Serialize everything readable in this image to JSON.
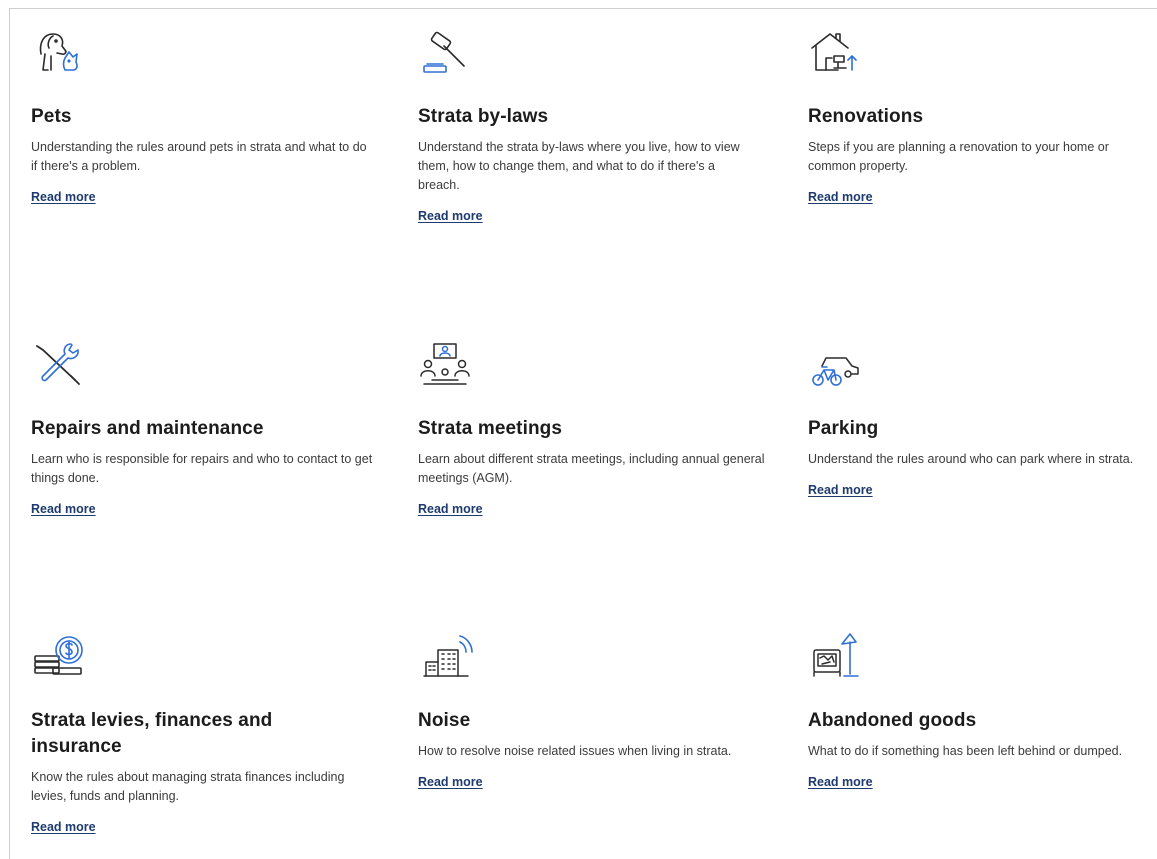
{
  "cards": [
    {
      "icon": "pet-dog-icon",
      "title": "Pets",
      "description": "Understanding the rules around pets in strata and what to do if there's a problem.",
      "link": "Read more"
    },
    {
      "icon": "gavel-icon",
      "title": "Strata by-laws",
      "description": "Understand the strata by-laws where you live, how to view them, how to change them, and what to do if there's a breach.",
      "link": "Read more"
    },
    {
      "icon": "house-renovation-icon",
      "title": "Renovations",
      "description": "Steps if you are planning a renovation to your home or common property.",
      "link": "Read more"
    },
    {
      "icon": "wrench-screwdriver-icon",
      "title": "Repairs and maintenance",
      "description": "Learn who is responsible for repairs and who to contact to get things done.",
      "link": "Read more"
    },
    {
      "icon": "meeting-table-icon",
      "title": "Strata meetings",
      "description": "Learn about different strata meetings, including annual general meetings (AGM).",
      "link": "Read more"
    },
    {
      "icon": "car-bicycle-icon",
      "title": "Parking",
      "description": "Understand the rules around who can park where in strata.",
      "link": "Read more"
    },
    {
      "icon": "coins-dollar-icon",
      "title": "Strata levies, finances and insurance",
      "description": "Know the rules about managing strata finances including levies, funds and planning.",
      "link": "Read more"
    },
    {
      "icon": "noise-building-icon",
      "title": "Noise",
      "description": "How to resolve noise related issues when living in strata.",
      "link": "Read more"
    },
    {
      "icon": "abandoned-goods-icon",
      "title": "Abandoned goods",
      "description": "What to do if something has been left behind or dumped.",
      "link": "Read more"
    }
  ],
  "colors": {
    "icon_dark": "#2b2b2b",
    "icon_accent": "#2f6fd6",
    "link": "#1e3a6e"
  }
}
